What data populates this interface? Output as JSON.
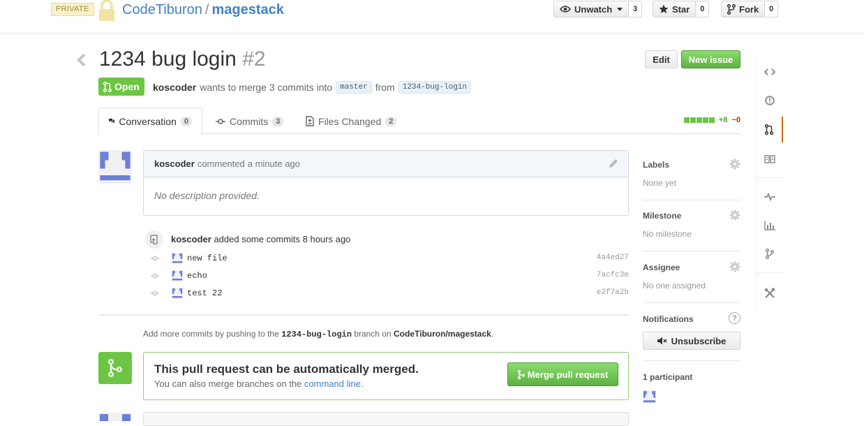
{
  "header": {
    "private_label": "PRIVATE",
    "owner": "CodeTiburon",
    "separator": "/",
    "repo": "magestack",
    "unwatch_label": "Unwatch",
    "unwatch_count": "3",
    "star_label": "Star",
    "star_count": "0",
    "fork_label": "Fork",
    "fork_count": "0"
  },
  "pull": {
    "title": "1234 bug login",
    "number": "#2",
    "edit_label": "Edit",
    "new_issue_label": "New issue",
    "state": "Open",
    "author": "koscoder",
    "merge_text": "wants to merge 3 commits into",
    "base_branch": "master",
    "from_text": "from",
    "head_branch": "1234-bug-login"
  },
  "tabs": [
    {
      "label": "Conversation",
      "count": "0"
    },
    {
      "label": "Commits",
      "count": "3"
    },
    {
      "label": "Files Changed",
      "count": "2"
    }
  ],
  "diffstat": {
    "additions": "+8",
    "deletions": "−0"
  },
  "comment": {
    "author": "koscoder",
    "action": "commented",
    "time": "a minute ago",
    "body": "No description provided."
  },
  "commit_event": {
    "author": "koscoder",
    "text": "added some commits",
    "time": "8 hours ago",
    "commits": [
      {
        "message": "new file",
        "sha": "4a4ed27"
      },
      {
        "message": "echo",
        "sha": "7acfc3e"
      },
      {
        "message": "test 22",
        "sha": "e2f7a2b"
      }
    ]
  },
  "push_hint": {
    "prefix": "Add more commits by pushing to the",
    "branch": "1234-bug-login",
    "middle": "branch on",
    "repo": "CodeTiburon/magestack",
    "suffix": "."
  },
  "merge": {
    "title": "This pull request can be automatically merged.",
    "sub_prefix": "You can also merge branches on the",
    "sub_link": "command line",
    "sub_suffix": ".",
    "button_label": "Merge pull request"
  },
  "sidebar": {
    "labels_title": "Labels",
    "labels_value": "None yet",
    "milestone_title": "Milestone",
    "milestone_value": "No milestone",
    "assignee_title": "Assignee",
    "assignee_value": "No one assigned",
    "notifications_title": "Notifications",
    "unsubscribe_label": "Unsubscribe",
    "participants_title": "1 participant"
  },
  "colors": {
    "accent_link": "#4183c4",
    "open_green": "#6cc644",
    "nav_active": "#d26911"
  }
}
